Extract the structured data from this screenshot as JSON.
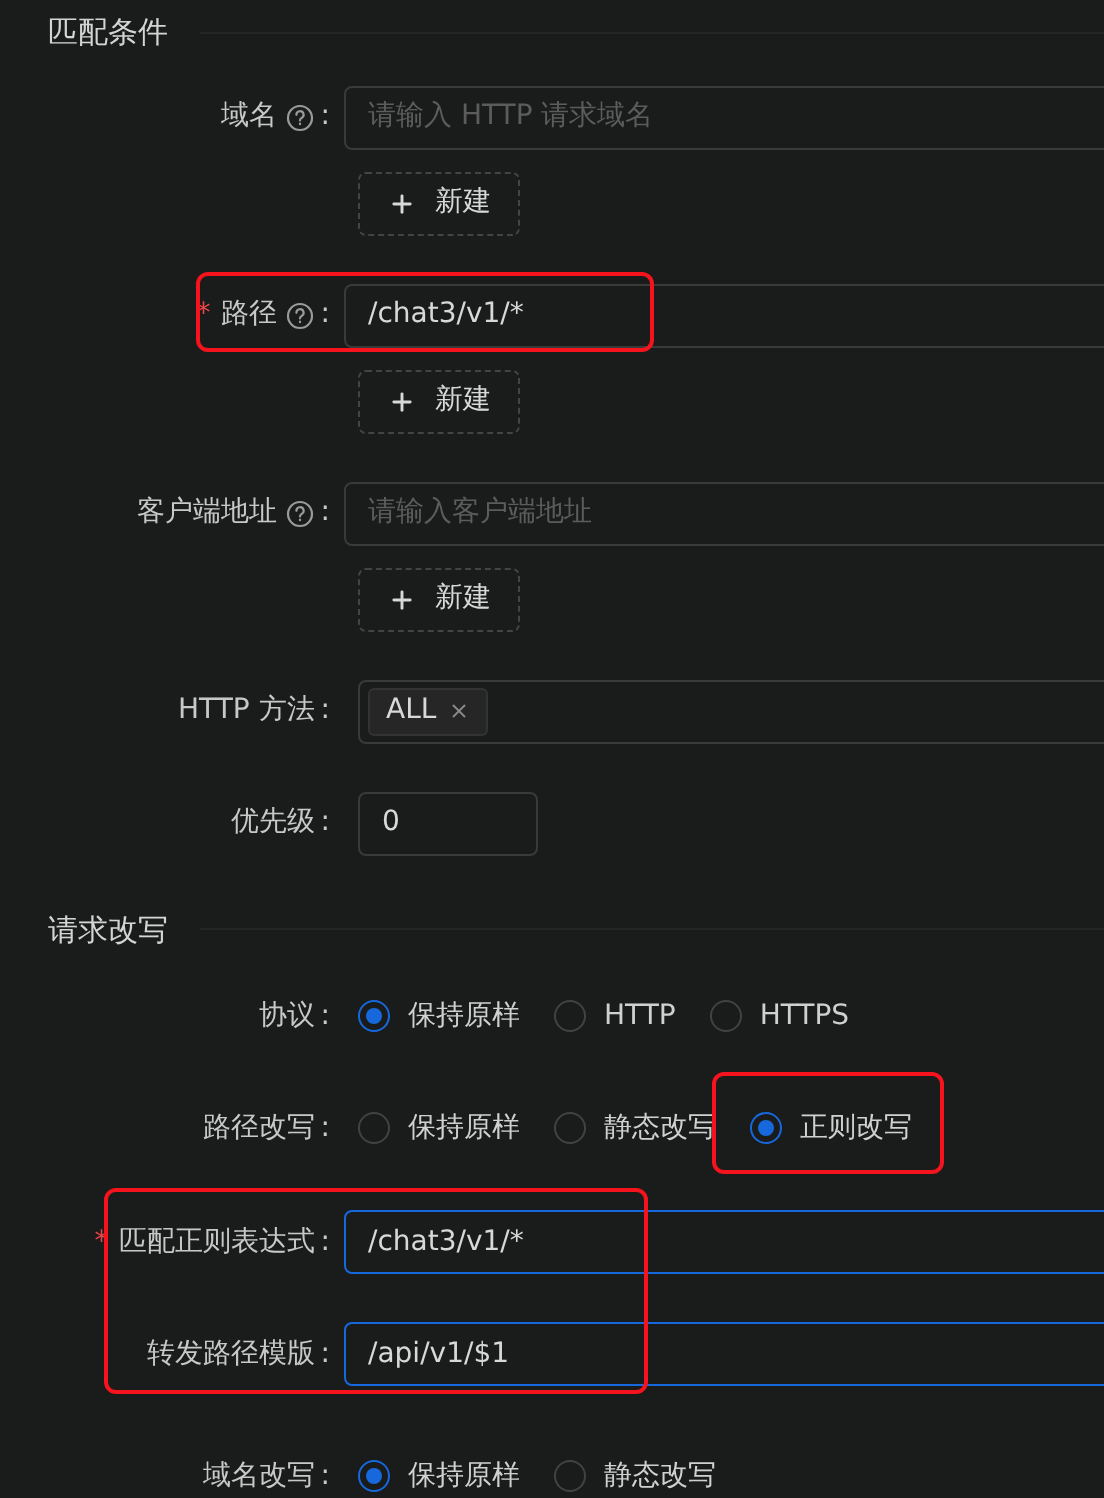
{
  "sections": [
    {
      "title": "匹配条件",
      "items": [
        {
          "kind": "input",
          "label": "域名",
          "help": true,
          "colon": ":",
          "placeholder": "请输入 HTTP 请求域名",
          "highlighted": false,
          "focused": false
        },
        {
          "kind": "add",
          "label": "新建"
        },
        {
          "kind": "input",
          "label": "路径",
          "help": true,
          "colon": ":",
          "required_mark": "*",
          "value": "/chat3/v1/*",
          "highlighted": true,
          "focused": false
        },
        {
          "kind": "add",
          "label": "新建"
        },
        {
          "kind": "input",
          "label": "客户端地址",
          "help": true,
          "colon": ":",
          "placeholder": "请输入客户端地址",
          "highlighted": false,
          "focused": false
        },
        {
          "kind": "add",
          "label": "新建"
        },
        {
          "kind": "tags",
          "label": "HTTP 方法",
          "help": false,
          "colon": ":",
          "tags": [
            "ALL"
          ]
        },
        {
          "kind": "number",
          "label": "优先级",
          "help": false,
          "colon": ":",
          "value": "0"
        }
      ]
    },
    {
      "title": "请求改写",
      "items": [
        {
          "kind": "radio",
          "label": "协议",
          "colon": ":",
          "options": [
            {
              "label": "保持原样",
              "selected": true,
              "highlighted": false
            },
            {
              "label": "HTTP",
              "selected": false,
              "highlighted": false
            },
            {
              "label": "HTTPS",
              "selected": false,
              "highlighted": false
            }
          ]
        },
        {
          "kind": "radio",
          "label": "路径改写",
          "colon": ":",
          "options": [
            {
              "label": "保持原样",
              "selected": false,
              "highlighted": false
            },
            {
              "label": "静态改写",
              "selected": false,
              "highlighted": false
            },
            {
              "label": "正则改写",
              "selected": true,
              "highlighted": true
            }
          ]
        },
        {
          "kind": "group",
          "highlighted": true,
          "items": [
            {
              "kind": "input",
              "label": "匹配正则表达式",
              "help": false,
              "colon": ":",
              "required_mark": "*",
              "value": "/chat3/v1/*",
              "highlighted": false,
              "focused": true
            },
            {
              "kind": "input",
              "label": "转发路径模版",
              "help": false,
              "colon": ":",
              "value": "/api/v1/$1",
              "highlighted": false,
              "focused": true
            }
          ]
        },
        {
          "kind": "radio",
          "label": "域名改写",
          "colon": ":",
          "options": [
            {
              "label": "保持原样",
              "selected": true,
              "highlighted": false
            },
            {
              "label": "静态改写",
              "selected": false,
              "highlighted": false
            }
          ]
        }
      ]
    }
  ]
}
